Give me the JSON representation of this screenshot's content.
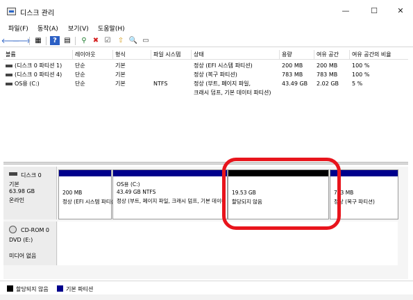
{
  "window": {
    "title": "디스크 관리",
    "minimize": "—",
    "maximize": "☐",
    "close": "✕"
  },
  "menu": [
    "파일(F)",
    "동작(A)",
    "보기(V)",
    "도움말(H)"
  ],
  "toolbar": {
    "back": "🡐",
    "forward": "🡒",
    "b1": "▦",
    "help": "?",
    "b2": "▤",
    "key": "⚲",
    "delete": "✖",
    "check": "☑",
    "up": "⇧",
    "search": "🔍",
    "b3": "▭",
    "delete_color": "#d51f1f"
  },
  "columns": [
    "볼륨",
    "레이아웃",
    "형식",
    "파일 시스템",
    "상태",
    "용량",
    "여유 공간",
    "여유 공간의 비율"
  ],
  "volumes": [
    {
      "name": "(디스크 0 파티션 1)",
      "layout": "단순",
      "type": "기본",
      "fs": "",
      "status": "정상 (EFI 시스템 파티션)",
      "status2": "",
      "capacity": "200 MB",
      "free": "200 MB",
      "pct": "100 %"
    },
    {
      "name": "(디스크 0 파티션 4)",
      "layout": "단순",
      "type": "기본",
      "fs": "",
      "status": "정상 (복구 파티션)",
      "status2": "",
      "capacity": "783 MB",
      "free": "783 MB",
      "pct": "100 %"
    },
    {
      "name": "OS용 (C:)",
      "layout": "단순",
      "type": "기본",
      "fs": "NTFS",
      "status": "정상 (부트, 페이지 파일,",
      "status2": "크래시 덤프, 기본 데이터 파티션)",
      "capacity": "43.49 GB",
      "free": "2.02 GB",
      "pct": "5 %"
    }
  ],
  "disk0": {
    "name": "디스크 0",
    "type": "기본",
    "size": "63.98 GB",
    "state": "온라인"
  },
  "partitions": [
    {
      "line1": "200 MB",
      "line2": "정상 (EFI 시스템 파티션)"
    },
    {
      "line1": "OS용 (C:)",
      "line2": "43.49 GB NTFS",
      "line3": "정상 (부트, 페이지 파일, 크래시 덤프, 기본 데이터 파티션)"
    },
    {
      "line1": "19.53 GB",
      "line2": "할당되지 않음"
    },
    {
      "line1": "783 MB",
      "line2": "정상 (복구 파티션)"
    }
  ],
  "cdrom": {
    "name": "CD-ROM 0",
    "drive": "DVD (E:)",
    "media": "미디어 없음"
  },
  "legend": [
    {
      "label": "할당되지 않음",
      "color": "#000000"
    },
    {
      "label": "기본 파티션",
      "color": "#00008c"
    }
  ],
  "colors": {
    "primary_partition": "#00008c",
    "unallocated": "#000000",
    "highlight": "#e8141c"
  }
}
